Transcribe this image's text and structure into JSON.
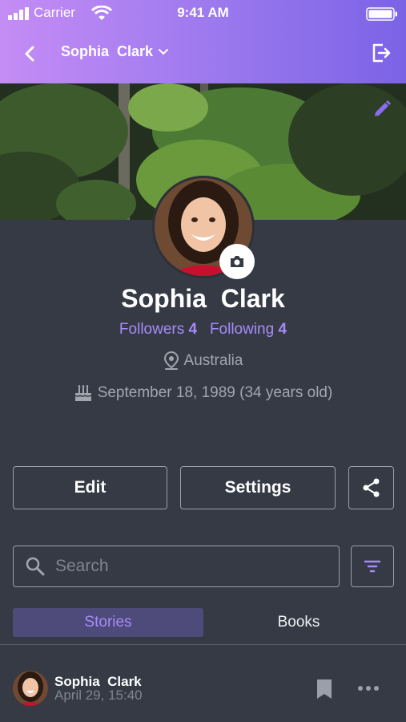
{
  "status_bar": {
    "carrier": "Carrier",
    "time": "9:41 AM"
  },
  "nav": {
    "title": "Sophia  Clark"
  },
  "profile": {
    "name": "Sophia  Clark",
    "followers_label": "Followers",
    "followers_count": "4",
    "following_label": "Following",
    "following_count": "4",
    "location": "Australia",
    "birthday": "September 18, 1989 (34 years old)"
  },
  "actions": {
    "edit_label": "Edit",
    "settings_label": "Settings"
  },
  "search": {
    "placeholder": "Search"
  },
  "tabs": [
    {
      "label": "Stories",
      "active": true
    },
    {
      "label": "Books",
      "active": false
    }
  ],
  "post": {
    "author": "Sophia  Clark",
    "timestamp": "April 29, 15:40"
  },
  "colors": {
    "accent": "#a78bfa",
    "background": "#353a45",
    "header_start": "#c58cf5",
    "header_end": "#7b63e6"
  }
}
